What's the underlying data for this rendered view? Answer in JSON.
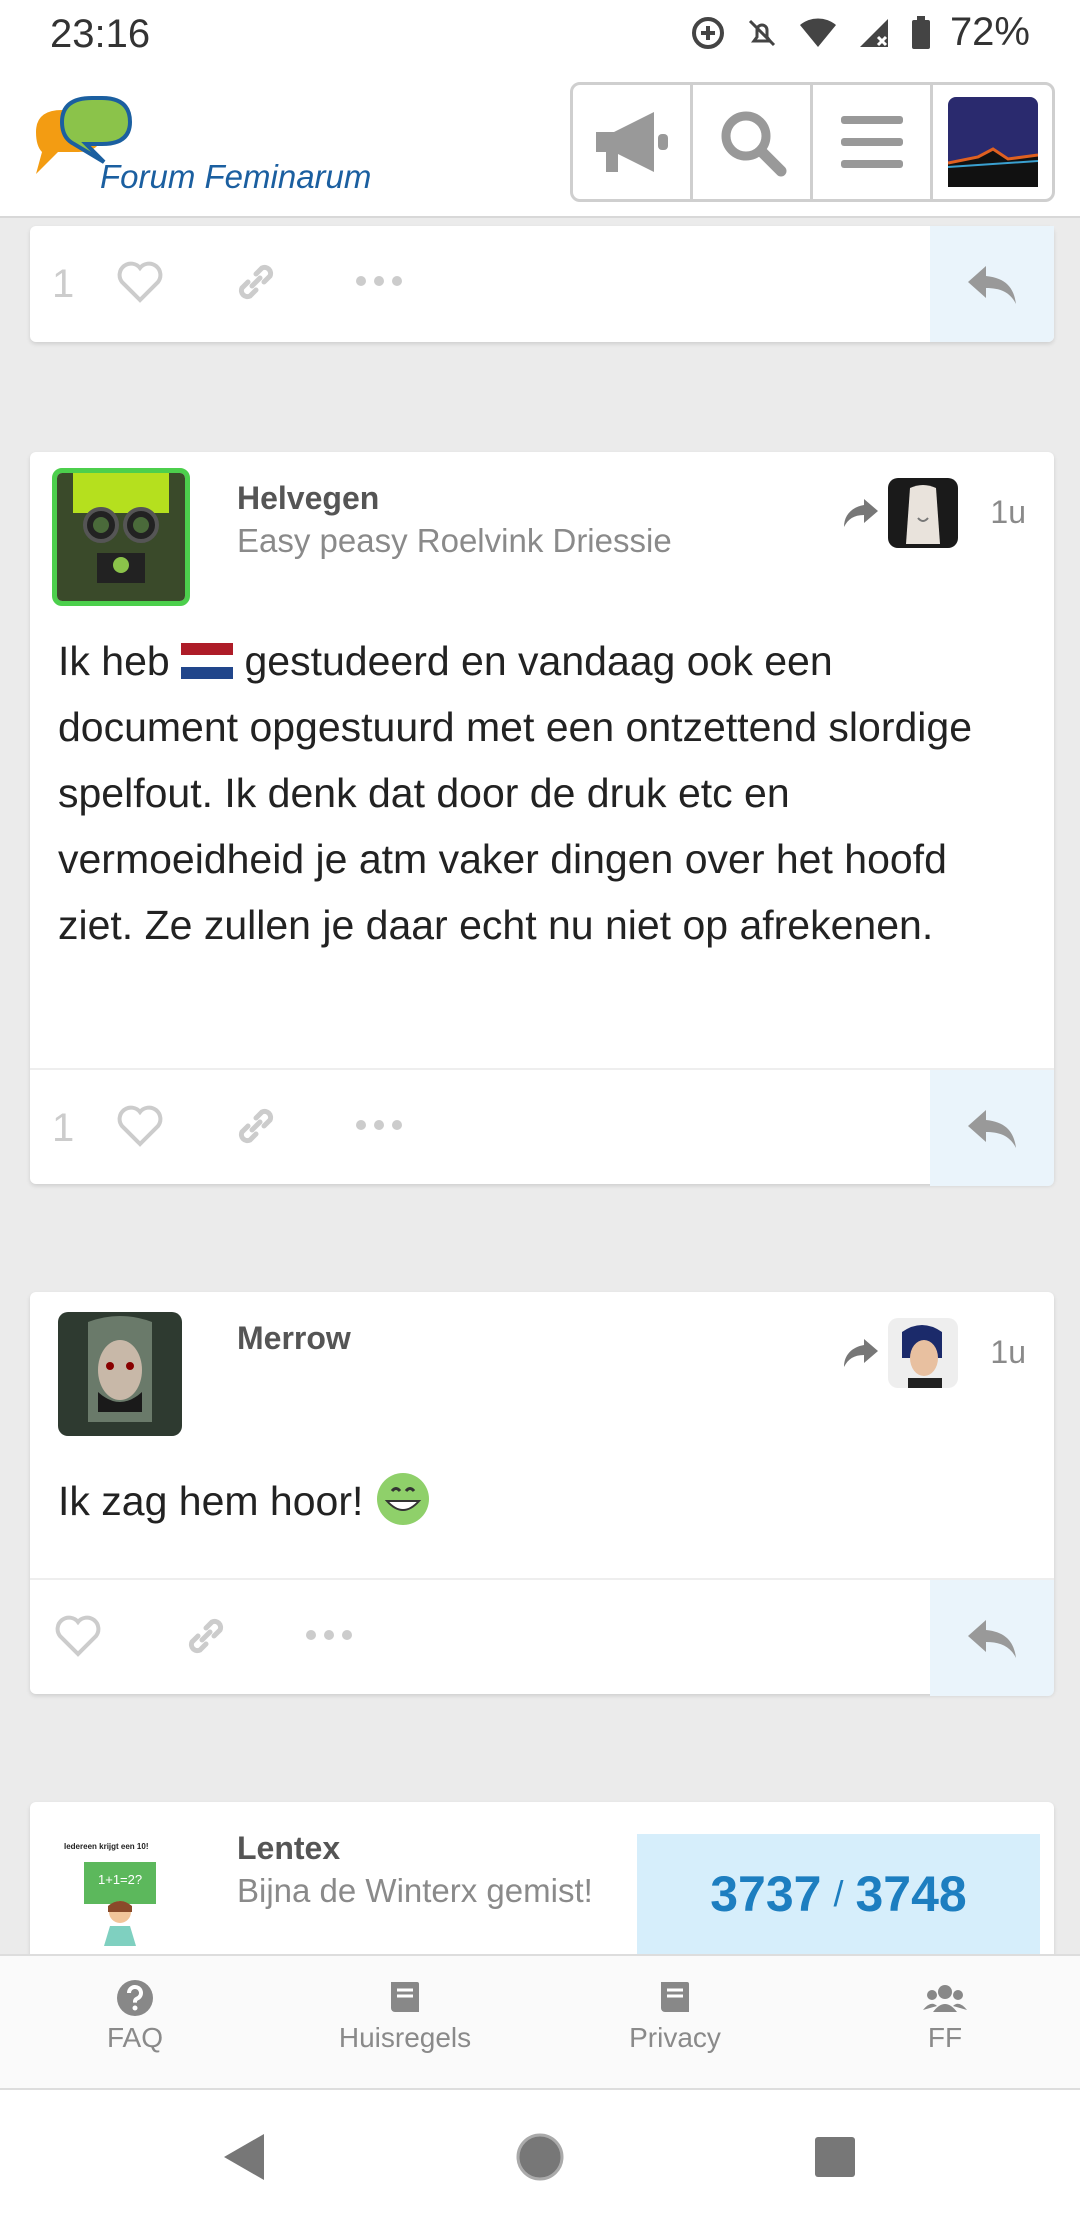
{
  "status_bar": {
    "time": "23:16",
    "battery": "72%"
  },
  "header": {
    "site_name": "Forum Feminarum"
  },
  "posts": [
    {
      "like_count": "1"
    },
    {
      "username": "Helvegen",
      "user_title": "Easy peasy Roelvink Driessie",
      "time_ago": "1u",
      "body_before_flag": "Ik heb ",
      "body_after_flag": " gestudeerd en vandaag ook een document opgestuurd met een ontzettend slordige spelfout. Ik denk dat door de druk etc en vermoeidheid je atm vaker dingen over het hoofd ziet. Ze zullen je daar echt nu niet op afrekenen.",
      "like_count": "1"
    },
    {
      "username": "Merrow",
      "user_title": "",
      "time_ago": "1u",
      "body": "Ik zag hem hoor!"
    },
    {
      "username": "Lentex",
      "user_title": "Bijna de Winterx gemist!",
      "avatar_caption": "Iedereen krijgt een 10!",
      "avatar_board": "1+1=2?"
    }
  ],
  "progress": {
    "current": "3737",
    "separator": "/",
    "total": "3748"
  },
  "footer": {
    "faq": "FAQ",
    "rules": "Huisregels",
    "privacy": "Privacy",
    "ff": "FF"
  },
  "colors": {
    "accent": "#1d7ec0",
    "progress_bg": "#d6eefb",
    "reply_bg": "#eaf4fb"
  }
}
